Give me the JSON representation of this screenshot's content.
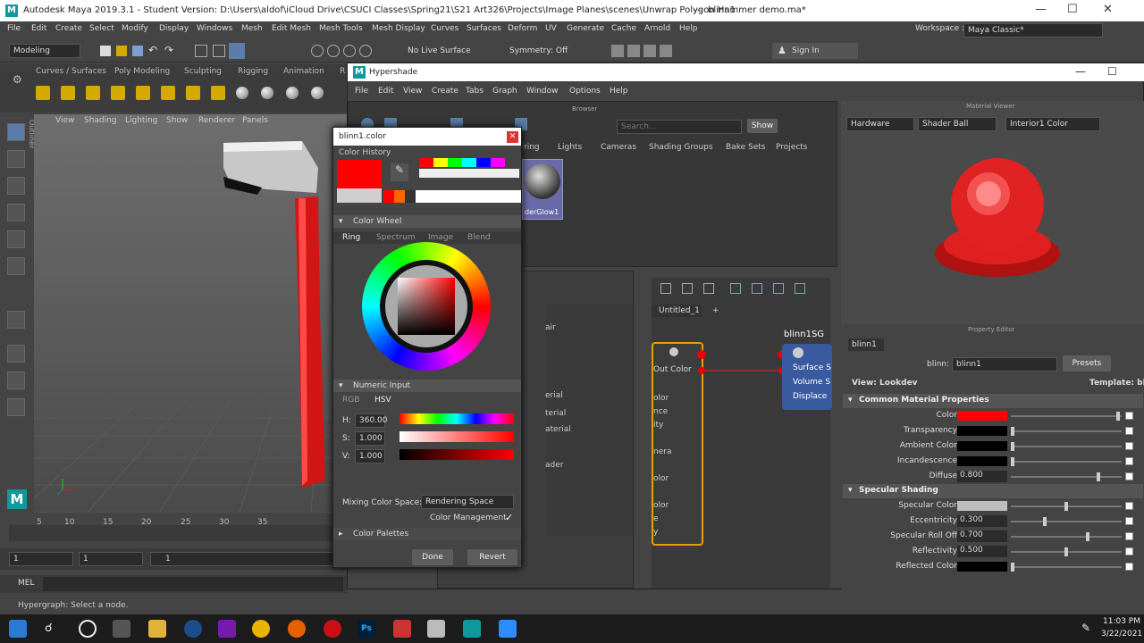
{
  "titlebar": {
    "title": "Autodesk Maya 2019.3.1 - Student Version: D:\\Users\\aldof\\iCloud Drive\\CSUCI Classes\\Spring21\\S21 Art326\\Projects\\Image Planes\\scenes\\Unwrap Polygon Hammer demo.ma*",
    "sep": "---",
    "node": "blinn1"
  },
  "menu": [
    "File",
    "Edit",
    "Create",
    "Select",
    "Modify",
    "Display",
    "Windows",
    "Mesh",
    "Edit Mesh",
    "Mesh Tools",
    "Mesh Display",
    "Curves",
    "Surfaces",
    "Deform",
    "UV",
    "Generate",
    "Cache",
    "Arnold",
    "Help"
  ],
  "workspace": {
    "label": "Workspace :",
    "value": "Maya Classic*"
  },
  "toolbar": {
    "mode": "Modeling",
    "live": "No Live Surface",
    "symmetry": "Symmetry: Off",
    "signin": "Sign In"
  },
  "shelf_tabs": [
    "Curves / Surfaces",
    "Poly Modeling",
    "Sculpting",
    "Rigging",
    "Animation",
    "R"
  ],
  "viewport_menu": [
    "View",
    "Shading",
    "Lighting",
    "Show",
    "Renderer",
    "Panels"
  ],
  "outliner_label": "Outliner",
  "timeline_ticks": [
    "5",
    "10",
    "15",
    "20",
    "25",
    "30",
    "35"
  ],
  "range": {
    "a": "1",
    "b": "1",
    "c": "1"
  },
  "mel": "MEL",
  "help_line": "Hypergraph: Select a node.",
  "clock": {
    "time": "11:03 PM",
    "date": "3/22/2021"
  },
  "taskbar_apps": [
    "Ps"
  ],
  "hypershade": {
    "title": "Hypershade",
    "menu": [
      "File",
      "Edit",
      "View",
      "Create",
      "Tabs",
      "Graph",
      "Window",
      "Options",
      "Help"
    ],
    "browser_label": "Browser",
    "search_placeholder": "Search...",
    "show": "Show",
    "tabs": [
      "ring",
      "Lights",
      "Cameras",
      "Shading Groups",
      "Bake Sets",
      "Projects"
    ],
    "swatch_label": "derGlow1",
    "graph_tab": "Untitled_1",
    "plus": "+",
    "list_frag": [
      "air",
      "erial",
      "terial",
      "aterial",
      "ader"
    ],
    "node_frag": [
      "olor",
      "nce",
      "ity",
      "nera",
      "olor",
      "olor",
      "e",
      "y"
    ],
    "node_out": "Out Color",
    "sg": {
      "name": "blinn1SG",
      "ports": [
        "Surface S",
        "Volume S",
        "Displace"
      ]
    },
    "material_viewer": {
      "label": "Material Viewer",
      "renderer": "Hardware",
      "shape": "Shader Ball",
      "env": "Interior1 Color"
    },
    "property_editor": {
      "label": "Property Editor",
      "tab": "blinn1",
      "blinn_label": "blinn:",
      "blinn_value": "blinn1",
      "presets": "Presets",
      "view": "View: Lookdev",
      "template": "Template: blin",
      "sections": [
        "Common Material Properties",
        "Specular Shading"
      ],
      "common": [
        {
          "label": "Color",
          "type": "color",
          "color": "#ff0000",
          "knob": 0.98
        },
        {
          "label": "Transparency",
          "type": "color",
          "color": "#000000",
          "knob": 0.0
        },
        {
          "label": "Ambient Color",
          "type": "color",
          "color": "#000000",
          "knob": 0.0
        },
        {
          "label": "Incandescence",
          "type": "color",
          "color": "#000000",
          "knob": 0.0
        },
        {
          "label": "Diffuse",
          "type": "value",
          "value": "0.800",
          "knob": 0.8
        }
      ],
      "specular": [
        {
          "label": "Specular Color",
          "type": "color",
          "color": "#bdbdbd",
          "knob": 0.5
        },
        {
          "label": "Eccentricity",
          "type": "value",
          "value": "0.300",
          "knob": 0.3
        },
        {
          "label": "Specular Roll Off",
          "type": "value",
          "value": "0.700",
          "knob": 0.7
        },
        {
          "label": "Reflectivity",
          "type": "value",
          "value": "0.500",
          "knob": 0.5
        },
        {
          "label": "Reflected Color",
          "type": "color",
          "color": "#000000",
          "knob": 0.0
        }
      ]
    }
  },
  "color_picker": {
    "title": "blinn1.color",
    "history": "Color History",
    "wheel": "Color Wheel",
    "wheel_tabs": [
      "Ring",
      "Spectrum",
      "Image",
      "Blend"
    ],
    "numeric": "Numeric Input",
    "mode_tabs": [
      "RGB",
      "HSV"
    ],
    "h": {
      "label": "H:",
      "value": "360.00"
    },
    "s": {
      "label": "S:",
      "value": "1.000"
    },
    "v": {
      "label": "V:",
      "value": "1.000"
    },
    "mixing_label": "Mixing Color Space:",
    "mixing_value": "Rendering Space",
    "cm": "Color Management",
    "cm_checked": "✓",
    "palettes": "Color Palettes",
    "done": "Done",
    "revert": "Revert",
    "current": "#ff0000",
    "previous": "#cfcfcf"
  }
}
